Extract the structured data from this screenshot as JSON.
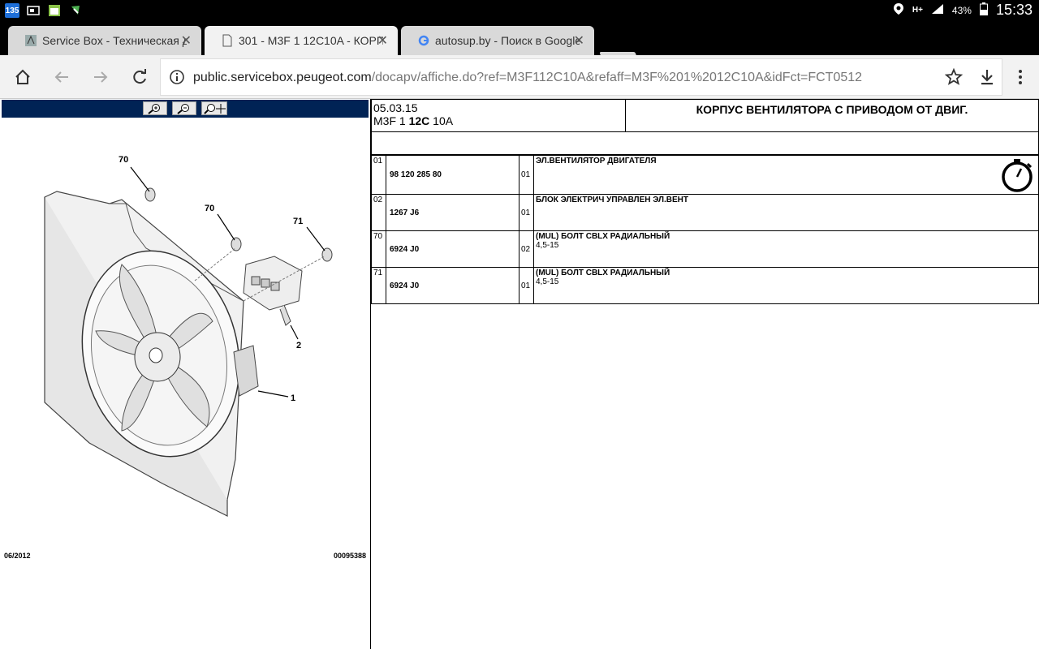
{
  "status_bar": {
    "notification_badge": "135",
    "battery_percent": "43%",
    "time": "15:33",
    "network_type": "H+"
  },
  "tabs": [
    {
      "title": "Service Box - Техническая д",
      "favicon": "peugeot-icon",
      "active": false
    },
    {
      "title": "301 - M3F 1 12C10A - КОРП",
      "favicon": "page-icon",
      "active": true
    },
    {
      "title": "autosup.by - Поиск в Google",
      "favicon": "google-icon",
      "active": false
    }
  ],
  "omnibox": {
    "url_host": "public.servicebox.peugeot.com",
    "url_path": "/docapv/affiche.do?ref=M3F112C10A&refaff=M3F%201%2012C10A&idFct=FCT0512"
  },
  "diagram": {
    "callouts": [
      "70",
      "70",
      "71",
      "2",
      "1"
    ],
    "footer_date": "06/2012",
    "footer_ref": "00095388"
  },
  "header": {
    "date": "05.03.15",
    "ref_prefix": "M3F 1 ",
    "ref_bold": "12C",
    "ref_suffix": " 10A",
    "title": "КОРПУС ВЕНТИЛЯТОРА С ПРИВОДОМ ОТ ДВИГ."
  },
  "parts": [
    {
      "pos": "01",
      "code": "98 120 285 80",
      "qty": "01",
      "desc": "ЭЛ.ВЕНТИЛЯТОР ДВИГАТЕЛЯ",
      "sub": ""
    },
    {
      "pos": "02",
      "code": "1267 J6",
      "qty": "01",
      "desc": "БЛОК ЭЛЕКТРИЧ УПРАВЛЕН ЭЛ.ВЕНТ",
      "sub": ""
    },
    {
      "pos": "70",
      "code": "6924 J0",
      "qty": "02",
      "desc": "(MUL) БОЛТ CBLX РАДИАЛЬНЫЙ",
      "sub": "4,5-15"
    },
    {
      "pos": "71",
      "code": "6924 J0",
      "qty": "01",
      "desc": "(MUL) БОЛТ CBLX РАДИАЛЬНЫЙ",
      "sub": "4,5-15"
    }
  ]
}
